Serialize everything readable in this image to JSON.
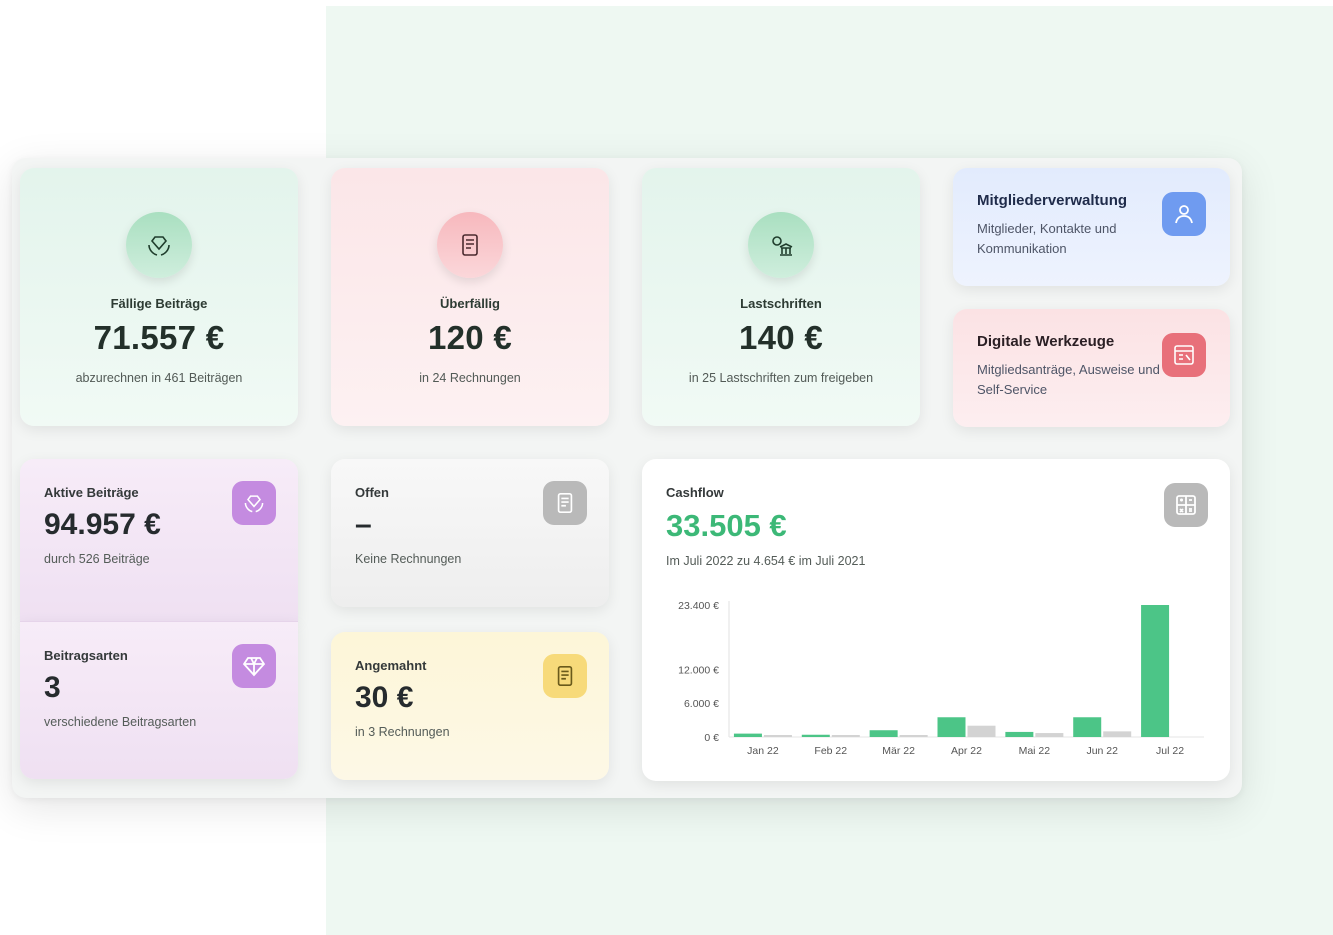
{
  "stats": [
    {
      "icon": "hands-gem-icon",
      "label": "Fällige Beiträge",
      "value": "71.557 €",
      "sub": "abzurechnen in 461 Beiträgen"
    },
    {
      "icon": "invoice-icon",
      "label": "Überfällig",
      "value": "120 €",
      "sub": "in 24 Rechnungen"
    },
    {
      "icon": "bank-transfer-icon",
      "label": "Lastschriften",
      "value": "140 €",
      "sub": "in 25 Lastschriften zum freigeben"
    }
  ],
  "features": [
    {
      "icon": "members-icon",
      "title": "Mitgliederverwaltung",
      "desc": "Mitglieder, Kontakte und Kommunikation",
      "color": "#6f9bf0"
    },
    {
      "icon": "digital-tools-icon",
      "title": "Digitale Werkzeuge",
      "desc": "Mitgliedsanträge, Ausweise und Self-Service",
      "color": "#e8707a"
    }
  ],
  "active": {
    "label": "Aktive Beiträge",
    "value": "94.957 €",
    "sub": "durch 526 Beiträge",
    "icon": "hands-gem-icon"
  },
  "types": {
    "label": "Beitragsarten",
    "value": "3",
    "sub": "verschiedene Beitragsarten",
    "icon": "diamond-icon"
  },
  "open": {
    "label": "Offen",
    "value": "–",
    "sub": "Keine Rechnungen",
    "icon": "invoice-icon"
  },
  "dunned": {
    "label": "Angemahnt",
    "value": "30 €",
    "sub": "in 3 Rechnungen",
    "icon": "invoice-icon"
  },
  "cashflow": {
    "label": "Cashflow",
    "value": "33.505 €",
    "sub": "Im Juli 2022 zu 4.654 € im Juli 2021",
    "icon": "calculator-icon"
  },
  "colors": {
    "accent_green": "#4cc587",
    "compare_grey": "#d3d3d3"
  },
  "chart_data": {
    "type": "bar",
    "categories": [
      "Jan 22",
      "Feb 22",
      "Mär 22",
      "Apr 22",
      "Mai 22",
      "Jun 22",
      "Jul 22"
    ],
    "series": [
      {
        "values": [
          600,
          400,
          1200,
          3500,
          900,
          3500,
          23400
        ]
      },
      {
        "values": [
          200,
          100,
          300,
          2000,
          700,
          1000,
          0
        ]
      }
    ],
    "y_ticks": [
      0,
      6000,
      12000,
      23400
    ],
    "y_tick_labels": [
      "0 €",
      "6.000 €",
      "12.000 €",
      "23.400 €"
    ],
    "ylim": [
      0,
      23400
    ],
    "grid": false
  }
}
